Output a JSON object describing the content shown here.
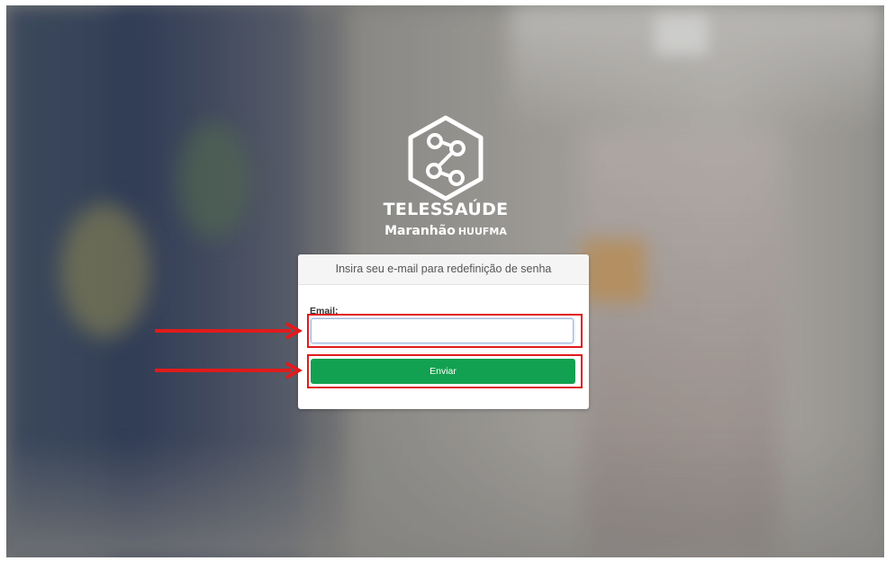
{
  "brand": {
    "logo_icon": "telessaude-hexagon-logo",
    "title": "TELESSAÚDE",
    "subtitle_main": "Maranhão",
    "subtitle_small": "HUUFMA"
  },
  "form": {
    "header": "Insira seu e-mail para redefinição de senha",
    "email_label": "Email:",
    "email_value": "",
    "submit_label": "Enviar"
  },
  "colors": {
    "accent_button": "#12a150",
    "annotation": "#e01b1b"
  }
}
